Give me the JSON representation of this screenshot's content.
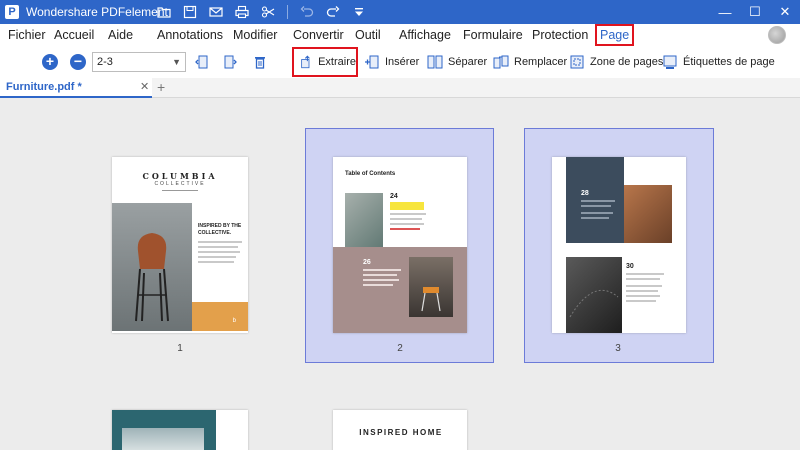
{
  "window": {
    "app_title": "Wondershare PDFelement",
    "logo_glyph": "P",
    "quick_icons": [
      "folder-icon",
      "save-icon",
      "mail-icon",
      "print-icon",
      "scissors-icon",
      "undo-icon",
      "redo-icon",
      "dropdown-icon"
    ],
    "controls": {
      "minimize": "—",
      "maximize": "☐",
      "close": "✕"
    }
  },
  "menu": {
    "items": [
      "Fichier",
      "Accueil",
      "Aide",
      "Annotations",
      "Modifier",
      "Convertir",
      "Outil",
      "Affichage",
      "Formulaire",
      "Protection",
      "Page"
    ],
    "active": "Page"
  },
  "toolbar": {
    "page_range": "2-3",
    "extraire": "Extraire",
    "inserer": "Insérer",
    "separer": "Séparer",
    "remplacer": "Remplacer",
    "zone_de_pages": "Zone de pages",
    "etiquettes_de_page": "Étiquettes de page"
  },
  "tabs": {
    "document": "Furniture.pdf *",
    "close": "✕",
    "add": "+"
  },
  "pages": {
    "p1": {
      "brand": "COLUMBIA",
      "sub": "COLLECTIVE",
      "heading": "INSPIRED BY THE COLLECTIVE.",
      "mark": "b",
      "number": "1",
      "selected": false
    },
    "p2": {
      "title": "Table of Contents",
      "n1": "24",
      "n2": "26",
      "number": "2",
      "selected": true
    },
    "p3": {
      "n1": "28",
      "n2": "30",
      "number": "3",
      "selected": true
    },
    "p5": {
      "title": "INSPIRED HOME"
    }
  },
  "colors": {
    "accent": "#2e66c8",
    "highlight_box": "#e0141e",
    "selection": "#cfd3f3"
  }
}
